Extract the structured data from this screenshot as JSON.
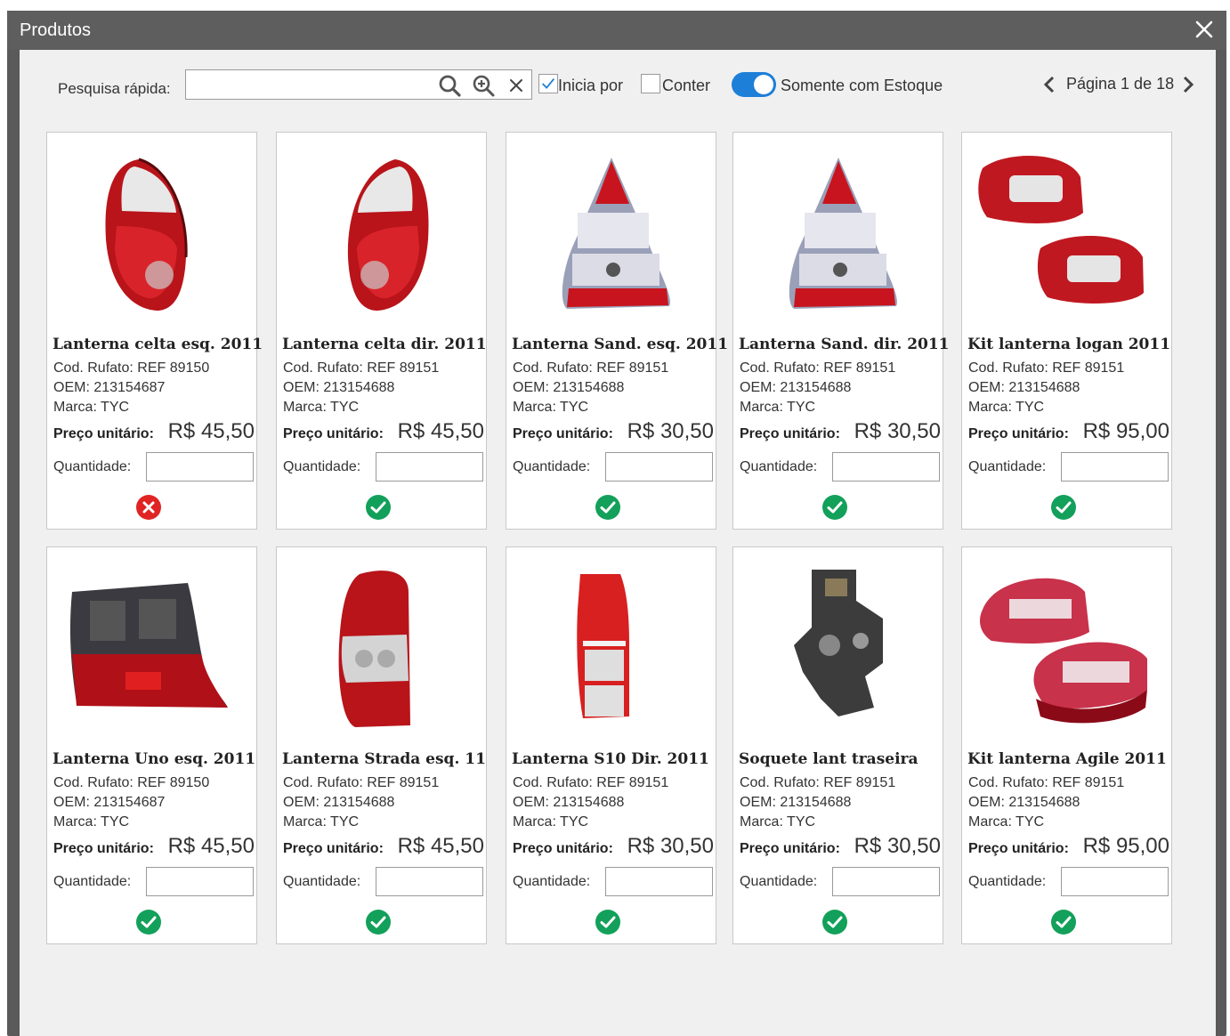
{
  "window": {
    "title": "Produtos"
  },
  "toolbar": {
    "search_label": "Pesquisa rápida:",
    "search_value": "",
    "search_placeholder": "",
    "starts_with_label": "Inicia por",
    "starts_with_checked": true,
    "contains_label": "Conter",
    "contains_checked": false,
    "stock_only_label": "Somente com Estoque",
    "stock_only_on": true,
    "page_text": "Página 1 de 18"
  },
  "colors": {
    "accent": "#1e7fd8",
    "ok": "#13a05a",
    "error": "#e02424",
    "titlebar": "#5e5e5e"
  },
  "products": [
    {
      "name": "Lanterna celta esq. 2011",
      "code": "Cod. Rufato: REF 89150",
      "oem": "OEM: 213154687",
      "brand": "Marca: TYC",
      "price_label": "Preço unitário:",
      "price": "R$ 45,50",
      "qty_label": "Quantidade:",
      "in_stock": false,
      "image": "celta-tail-light"
    },
    {
      "name": "Lanterna celta dir. 2011",
      "code": "Cod. Rufato: REF 89151",
      "oem": "OEM: 213154688",
      "brand": "Marca: TYC",
      "price_label": "Preço unitário:",
      "price": "R$ 45,50",
      "qty_label": "Quantidade:",
      "in_stock": true,
      "image": "celta-tail-light-mirrored"
    },
    {
      "name": "Lanterna Sand. esq. 2011",
      "code": "Cod. Rufato: REF 89151",
      "oem": "OEM: 213154688",
      "brand": "Marca: TYC",
      "price_label": "Preço unitário:",
      "price": "R$ 30,50",
      "qty_label": "Quantidade:",
      "in_stock": true,
      "image": "sandero-tail-light"
    },
    {
      "name": "Lanterna Sand. dir. 2011",
      "code": "Cod. Rufato: REF 89151",
      "oem": "OEM: 213154688",
      "brand": "Marca: TYC",
      "price_label": "Preço unitário:",
      "price": "R$ 30,50",
      "qty_label": "Quantidade:",
      "in_stock": true,
      "image": "sandero-tail-light"
    },
    {
      "name": "Kit lanterna logan 2011",
      "code": "Cod. Rufato: REF 89151",
      "oem": "OEM: 213154688",
      "brand": "Marca: TYC",
      "price_label": "Preço unitário:",
      "price": "R$ 95,00",
      "qty_label": "Quantidade:",
      "in_stock": true,
      "image": "logan-tail-light-pair"
    },
    {
      "name": "Lanterna Uno esq. 2011",
      "code": "Cod. Rufato: REF 89150",
      "oem": "OEM: 213154687",
      "brand": "Marca: TYC",
      "price_label": "Preço unitário:",
      "price": "R$ 45,50",
      "qty_label": "Quantidade:",
      "in_stock": true,
      "image": "uno-tail-light"
    },
    {
      "name": "Lanterna  Strada esq. 11",
      "code": "Cod. Rufato: REF 89151",
      "oem": "OEM: 213154688",
      "brand": "Marca: TYC",
      "price_label": "Preço unitário:",
      "price": "R$ 45,50",
      "qty_label": "Quantidade:",
      "in_stock": true,
      "image": "strada-tail-light"
    },
    {
      "name": "Lanterna S10 Dir. 2011",
      "code": "Cod. Rufato: REF 89151",
      "oem": "OEM: 213154688",
      "brand": "Marca: TYC",
      "price_label": "Preço unitário:",
      "price": "R$ 30,50",
      "qty_label": "Quantidade:",
      "in_stock": true,
      "image": "s10-tail-light"
    },
    {
      "name": "Soquete lant traseira",
      "code": "Cod. Rufato: REF 89151",
      "oem": "OEM: 213154688",
      "brand": "Marca: TYC",
      "price_label": "Preço unitário:",
      "price": "R$ 30,50",
      "qty_label": "Quantidade:",
      "in_stock": true,
      "image": "lamp-socket"
    },
    {
      "name": "Kit lanterna Agile 2011",
      "code": "Cod. Rufato: REF 89151",
      "oem": "OEM: 213154688",
      "brand": "Marca: TYC",
      "price_label": "Preço unitário:",
      "price": "R$ 95,00",
      "qty_label": "Quantidade:",
      "in_stock": true,
      "image": "agile-tail-light-pair"
    }
  ]
}
